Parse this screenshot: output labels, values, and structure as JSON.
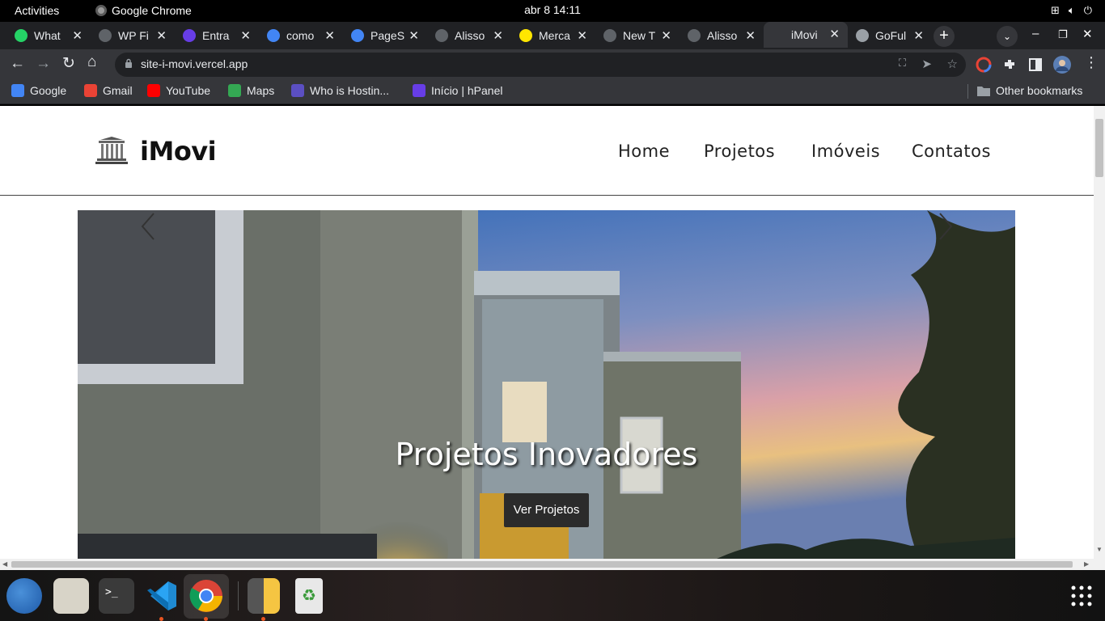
{
  "system_bar": {
    "activities": "Activities",
    "app_name": "Google Chrome",
    "datetime": "abr 8  14:11"
  },
  "tabs": [
    {
      "title": "What",
      "icon": "whatsapp-icon",
      "color": "#25d366"
    },
    {
      "title": "WP Fi",
      "icon": "globe-icon",
      "color": "#5f6368"
    },
    {
      "title": "Entra",
      "icon": "hostinger-icon",
      "color": "#673de6"
    },
    {
      "title": "como",
      "icon": "google-icon",
      "color": "#4285f4"
    },
    {
      "title": "PageS",
      "icon": "pagespeed-icon",
      "color": "#4285f4"
    },
    {
      "title": "Alisso",
      "icon": "globe-icon",
      "color": "#5f6368"
    },
    {
      "title": "Merca",
      "icon": "mercado-icon",
      "color": "#ffe600"
    },
    {
      "title": "New T",
      "icon": "chrome-icon",
      "color": "#5f6368"
    },
    {
      "title": "Alisso",
      "icon": "globe-icon",
      "color": "#5f6368"
    },
    {
      "title": "iMovi",
      "icon": "",
      "color": "",
      "active": true
    },
    {
      "title": "GoFul",
      "icon": "camera-icon",
      "color": "#9aa0a6"
    }
  ],
  "address_bar": {
    "url": "site-i-movi.vercel.app"
  },
  "bookmarks": [
    {
      "label": "Google",
      "icon": "google-icon"
    },
    {
      "label": "Gmail",
      "icon": "gmail-icon"
    },
    {
      "label": "YouTube",
      "icon": "youtube-icon"
    },
    {
      "label": "Maps",
      "icon": "maps-icon"
    },
    {
      "label": "Who is Hostin...",
      "icon": "d-icon"
    },
    {
      "label": "Início | hPanel",
      "icon": "hostinger-icon"
    }
  ],
  "other_bookmarks": "Other bookmarks",
  "site": {
    "brand": "iMovi",
    "nav": [
      "Home",
      "Projetos",
      "Imóveis",
      "Contatos"
    ],
    "hero_title": "Projetos Inovadores",
    "hero_button": "Ver Projetos"
  },
  "colors": {
    "chrome_dark": "#202124",
    "chrome_toolbar": "#35363a",
    "dock_indicator": "#e95420"
  }
}
